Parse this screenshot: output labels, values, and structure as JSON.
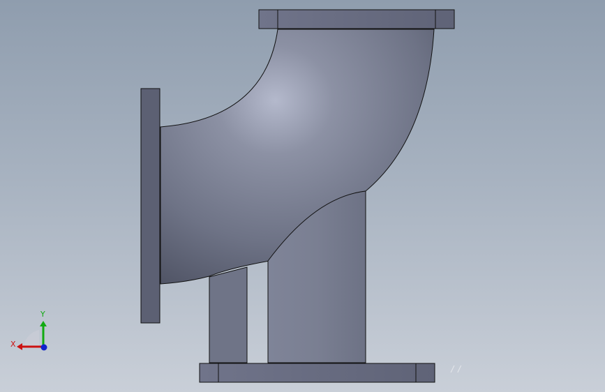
{
  "viewport": {
    "background_top": "#8f9dae",
    "background_bottom": "#c9cfd8"
  },
  "model": {
    "description_icon": "pipe-elbow-with-support-icon",
    "colors": {
      "flange": "#6c7083",
      "flange_dark": "#5a5e70",
      "pipe_light": "#9aa0b4",
      "pipe_mid": "#767b8e",
      "pipe_dark": "#4e5263",
      "edge": "#111111"
    }
  },
  "triad": {
    "x_label": "X",
    "y_label": "Y",
    "x_color": "#cc1111",
    "y_color": "#11aa11",
    "z_color": "#1122cc"
  },
  "watermark": {
    "text": "/ /"
  }
}
